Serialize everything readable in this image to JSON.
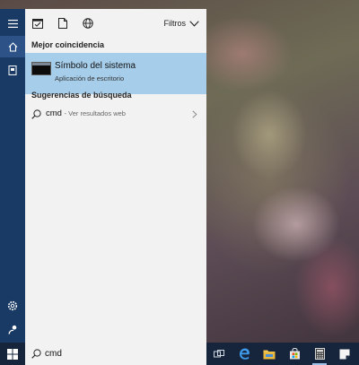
{
  "filters": {
    "label": "Filtros"
  },
  "best_match": {
    "section_title": "Mejor coincidencia",
    "title": "Símbolo del sistema",
    "subtitle": "Aplicación de escritorio"
  },
  "suggestions": {
    "section_title": "Sugerencias de búsqueda",
    "items": [
      {
        "query": "cmd",
        "hint": "- Ver resultados web"
      }
    ]
  },
  "search": {
    "value": "cmd"
  },
  "icons": {
    "rail": [
      "hamburger-icon",
      "home-icon",
      "notebook-icon",
      "settings-icon",
      "feedback-icon"
    ],
    "toolbar": [
      "apps-icon",
      "document-icon",
      "web-icon",
      "chevron-down-icon"
    ],
    "taskbar": [
      "windows-logo-icon",
      "search-icon",
      "task-view-icon",
      "edge-icon",
      "file-explorer-icon",
      "store-icon",
      "calculator-icon",
      "sticky-notes-icon"
    ]
  },
  "colors": {
    "rail": "#1a3a66",
    "panel": "#f2f2f2",
    "selected_result": "#a6cdea",
    "taskbar": "#16243c"
  }
}
